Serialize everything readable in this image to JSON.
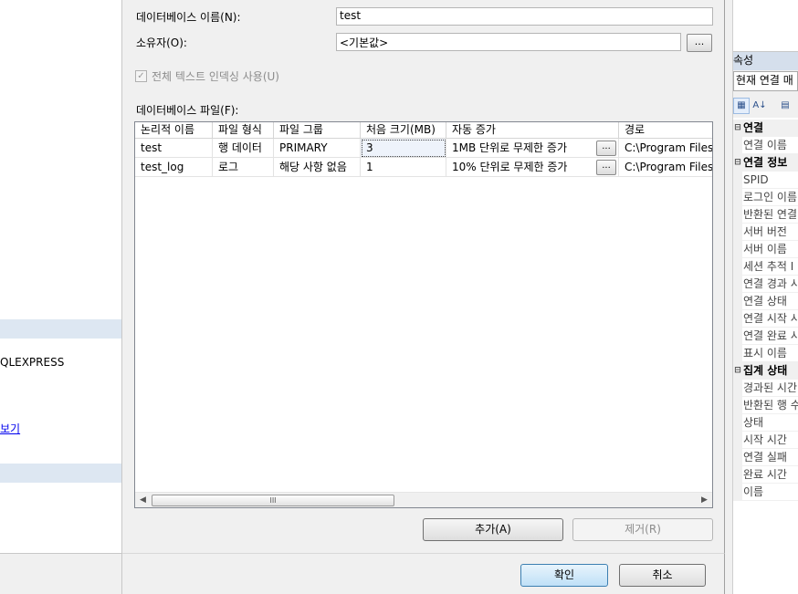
{
  "left_panel": {
    "server_name": "QLEXPRESS",
    "link_text": "보기"
  },
  "form": {
    "db_name_label": "데이터베이스 이름(N):",
    "db_name_value": "test",
    "owner_label": "소유자(O):",
    "owner_value": "<기본값>",
    "owner_browse": "...",
    "fulltext_label": "전체 텍스트 인덱싱 사용(U)",
    "fulltext_checked": true,
    "files_label": "데이터베이스 파일(F):"
  },
  "files_table": {
    "columns": [
      "논리적 이름",
      "파일 형식",
      "파일 그룹",
      "처음 크기(MB)",
      "자동 증가",
      "경로"
    ],
    "rows": [
      {
        "logical_name": "test",
        "file_type": "행 데이터",
        "filegroup": "PRIMARY",
        "initial_size": "3",
        "autogrowth": "1MB 단위로 무제한 증가",
        "path": "C:\\Program Files"
      },
      {
        "logical_name": "test_log",
        "file_type": "로그",
        "filegroup": "해당 사항 없음",
        "initial_size": "1",
        "autogrowth": "10% 단위로 무제한 증가",
        "path": "C:\\Program Files"
      }
    ],
    "cell_button": "...",
    "scroll_thumb": "III"
  },
  "buttons": {
    "add": "추가(A)",
    "remove": "제거(R)",
    "ok": "확인",
    "cancel": "취소"
  },
  "properties_panel": {
    "title": "속성",
    "selected_object": "현재 연결 매",
    "items": [
      {
        "kind": "cat",
        "text": "연결"
      },
      {
        "kind": "item",
        "text": "연결 이름"
      },
      {
        "kind": "cat",
        "text": "연결 정보"
      },
      {
        "kind": "item",
        "text": "SPID"
      },
      {
        "kind": "item",
        "text": "로그인 이름"
      },
      {
        "kind": "item",
        "text": "반환된 연결"
      },
      {
        "kind": "item",
        "text": "서버 버전"
      },
      {
        "kind": "item",
        "text": "서버 이름"
      },
      {
        "kind": "item",
        "text": "세션 추적 I"
      },
      {
        "kind": "item",
        "text": "연결 경과 시"
      },
      {
        "kind": "item",
        "text": "연결 상태"
      },
      {
        "kind": "item",
        "text": "연결 시작 시"
      },
      {
        "kind": "item",
        "text": "연결 완료 시"
      },
      {
        "kind": "item",
        "text": "표시 이름"
      },
      {
        "kind": "cat",
        "text": "집계 상태"
      },
      {
        "kind": "item",
        "text": "경과된 시간"
      },
      {
        "kind": "item",
        "text": "반환된 행 수"
      },
      {
        "kind": "item",
        "text": "상태"
      },
      {
        "kind": "item",
        "text": "시작 시간"
      },
      {
        "kind": "item",
        "text": "연결 실패"
      },
      {
        "kind": "item",
        "text": "완료 시간"
      },
      {
        "kind": "item",
        "text": "이름"
      }
    ]
  }
}
